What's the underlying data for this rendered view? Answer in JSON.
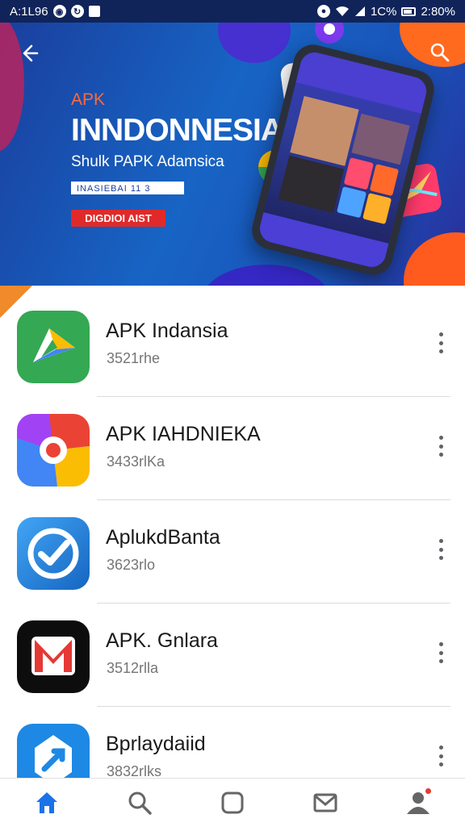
{
  "status_bar": {
    "time": "A:1L96",
    "wifi_signal": "1C%",
    "battery": "2:80%"
  },
  "hero": {
    "small_label": "APK",
    "title": "INNDONNESIA",
    "subtitle": "Shulk PAPK Adamsica",
    "box_text": "INASIEBAI 11 3",
    "button_label": "DIGDIOI AIST"
  },
  "apps": [
    {
      "name": "APK Indansia",
      "meta": "3521rhe",
      "icon": "play-store-icon"
    },
    {
      "name": "APK IAHDNIEKA",
      "meta": "3433rlKa",
      "icon": "chrome-style-icon"
    },
    {
      "name": "AplukdBanta",
      "meta": "3623rlo",
      "icon": "check-circle-icon"
    },
    {
      "name": "APK. Gnlara",
      "meta": "3512rlla",
      "icon": "m-logo-icon"
    },
    {
      "name": "Bprlaydaiid",
      "meta": "3832rlks",
      "icon": "tools-icon"
    }
  ],
  "bottom_nav": [
    {
      "id": "home",
      "icon": "home-icon",
      "active": true
    },
    {
      "id": "search",
      "icon": "search-icon"
    },
    {
      "id": "apps",
      "icon": "square-icon"
    },
    {
      "id": "messages",
      "icon": "mail-icon"
    },
    {
      "id": "profile",
      "icon": "user-icon",
      "badge": true
    }
  ],
  "colors": {
    "accent": "#1a73e8",
    "hero_bg": "#1764c4",
    "button_red": "#e02a2a"
  }
}
